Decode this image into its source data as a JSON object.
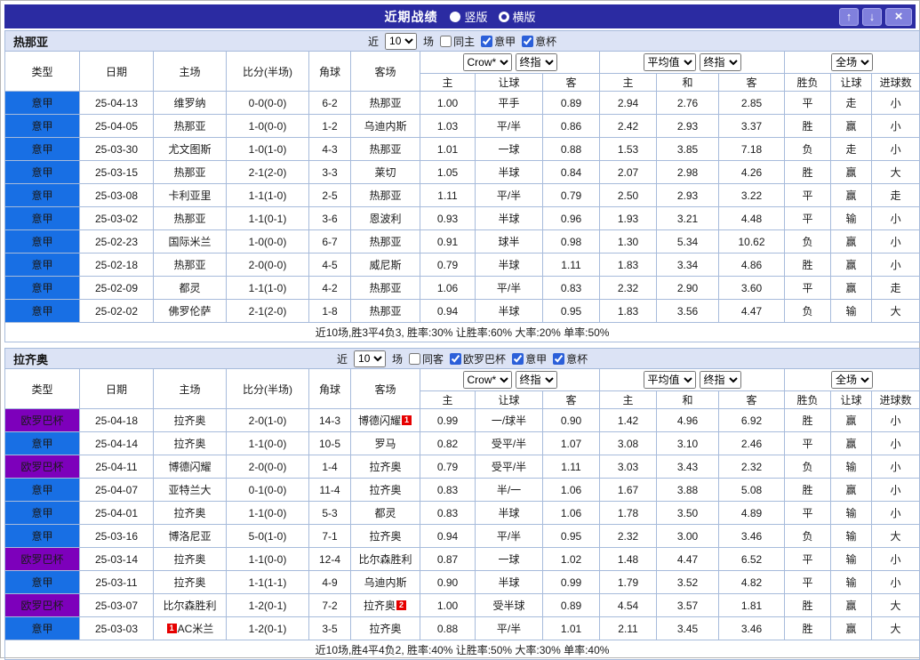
{
  "titlebar": {
    "title": "近期战绩",
    "options": [
      {
        "label": "竖版",
        "selected": false
      },
      {
        "label": "横版",
        "selected": true
      }
    ],
    "buttons": {
      "up": "↑",
      "down": "↓",
      "close": "×"
    }
  },
  "header_labels": {
    "left": [
      "类型",
      "日期",
      "主场",
      "比分(半场)",
      "角球",
      "客场"
    ],
    "group1": [
      "主",
      "让球",
      "客"
    ],
    "group2": [
      "主",
      "和",
      "客"
    ],
    "group3": [
      "胜负",
      "让球",
      "进球数"
    ],
    "selects": {
      "odds_source": "Crow*",
      "stage1": "终指",
      "avg": "平均值",
      "stage2": "终指",
      "scope": "全场"
    }
  },
  "colors": {
    "league_serie_a": "#186fe4",
    "league_europa": "#7d00bb",
    "win": "#e60000",
    "loss": "#00912c",
    "push_purple": "#7700cc",
    "titlebar": "#2b2ba2",
    "section_bg": "#dce3f5"
  },
  "sections": [
    {
      "team": "热那亚",
      "filters": {
        "near": "近",
        "count": "10",
        "unit": "场",
        "checkboxes": [
          {
            "label": "同主",
            "checked": false
          },
          {
            "label": "意甲",
            "checked": true
          },
          {
            "label": "意杯",
            "checked": true
          }
        ]
      },
      "summary": "近10场,胜3平4负3, 胜率:30% 让胜率:60% 大率:20% 单率:50%",
      "rows": [
        {
          "league": "意甲",
          "lc": "blue",
          "date": "25-04-13",
          "home": "维罗纳",
          "hg": false,
          "score": "0-0(0-0)",
          "corner": "6-2",
          "away": "热那亚",
          "ag": true,
          "o1": "1.00",
          "hcp": "平手",
          "o2": "0.89",
          "m1": "2.94",
          "m2": "2.76",
          "m3": "2.85",
          "res": "平",
          "resc": "k",
          "lres": "走",
          "lresc": "g",
          "ou": "小",
          "ouc": "g"
        },
        {
          "league": "意甲",
          "lc": "blue",
          "date": "25-04-05",
          "home": "热那亚",
          "hg": true,
          "score": "1-0(0-0)",
          "corner": "1-2",
          "away": "乌迪内斯",
          "ag": false,
          "o1": "1.03",
          "hcp": "平/半",
          "o2": "0.86",
          "m1": "2.42",
          "m2": "2.93",
          "m3": "3.37",
          "res": "胜",
          "resc": "r",
          "lres": "赢",
          "lresc": "r",
          "ou": "小",
          "ouc": "g"
        },
        {
          "league": "意甲",
          "lc": "blue",
          "date": "25-03-30",
          "home": "尤文图斯",
          "hg": false,
          "score": "1-0(1-0)",
          "corner": "4-3",
          "away": "热那亚",
          "ag": true,
          "o1": "1.01",
          "hcp": "一球",
          "o2": "0.88",
          "m1": "1.53",
          "m2": "3.85",
          "m3": "7.18",
          "res": "负",
          "resc": "g",
          "lres": "走",
          "lresc": "g",
          "ou": "小",
          "ouc": "g"
        },
        {
          "league": "意甲",
          "lc": "blue",
          "date": "25-03-15",
          "home": "热那亚",
          "hg": true,
          "score": "2-1(2-0)",
          "corner": "3-3",
          "away": "莱切",
          "ag": false,
          "o1": "1.05",
          "hcp": "半球",
          "o2": "0.84",
          "m1": "2.07",
          "m2": "2.98",
          "m3": "4.26",
          "res": "胜",
          "resc": "r",
          "lres": "赢",
          "lresc": "r",
          "ou": "大",
          "ouc": "r"
        },
        {
          "league": "意甲",
          "lc": "blue",
          "date": "25-03-08",
          "home": "卡利亚里",
          "hg": false,
          "score": "1-1(1-0)",
          "corner": "2-5",
          "away": "热那亚",
          "ag": true,
          "o1": "1.11",
          "hcp": "平/半",
          "o2": "0.79",
          "m1": "2.50",
          "m2": "2.93",
          "m3": "3.22",
          "res": "平",
          "resc": "k",
          "lres": "赢",
          "lresc": "r",
          "ou": "走",
          "ouc": "g"
        },
        {
          "league": "意甲",
          "lc": "blue",
          "date": "25-03-02",
          "home": "热那亚",
          "hg": true,
          "score": "1-1(0-1)",
          "corner": "3-6",
          "away": "恩波利",
          "ag": false,
          "o1": "0.93",
          "hcp": "半球",
          "o2": "0.96",
          "m1": "1.93",
          "m2": "3.21",
          "m3": "4.48",
          "res": "平",
          "resc": "k",
          "lres": "输",
          "lresc": "p",
          "ou": "小",
          "ouc": "g"
        },
        {
          "league": "意甲",
          "lc": "blue",
          "date": "25-02-23",
          "home": "国际米兰",
          "hg": false,
          "score": "1-0(0-0)",
          "corner": "6-7",
          "away": "热那亚",
          "ag": true,
          "o1": "0.91",
          "hcp": "球半",
          "o2": "0.98",
          "m1": "1.30",
          "m2": "5.34",
          "m3": "10.62",
          "res": "负",
          "resc": "g",
          "lres": "赢",
          "lresc": "r",
          "ou": "小",
          "ouc": "g"
        },
        {
          "league": "意甲",
          "lc": "blue",
          "date": "25-02-18",
          "home": "热那亚",
          "hg": true,
          "score": "2-0(0-0)",
          "corner": "4-5",
          "away": "威尼斯",
          "ag": false,
          "o1": "0.79",
          "hcp": "半球",
          "o2": "1.11",
          "m1": "1.83",
          "m2": "3.34",
          "m3": "4.86",
          "res": "胜",
          "resc": "r",
          "lres": "赢",
          "lresc": "r",
          "ou": "小",
          "ouc": "g"
        },
        {
          "league": "意甲",
          "lc": "blue",
          "date": "25-02-09",
          "home": "都灵",
          "hg": false,
          "score": "1-1(1-0)",
          "corner": "4-2",
          "away": "热那亚",
          "ag": true,
          "o1": "1.06",
          "hcp": "平/半",
          "o2": "0.83",
          "m1": "2.32",
          "m2": "2.90",
          "m3": "3.60",
          "res": "平",
          "resc": "k",
          "lres": "赢",
          "lresc": "r",
          "ou": "走",
          "ouc": "g"
        },
        {
          "league": "意甲",
          "lc": "blue",
          "date": "25-02-02",
          "home": "佛罗伦萨",
          "hg": false,
          "score": "2-1(2-0)",
          "corner": "1-8",
          "away": "热那亚",
          "ag": true,
          "o1": "0.94",
          "hcp": "半球",
          "o2": "0.95",
          "m1": "1.83",
          "m2": "3.56",
          "m3": "4.47",
          "res": "负",
          "resc": "g",
          "lres": "输",
          "lresc": "p",
          "ou": "大",
          "ouc": "r"
        }
      ]
    },
    {
      "team": "拉齐奥",
      "filters": {
        "near": "近",
        "count": "10",
        "unit": "场",
        "checkboxes": [
          {
            "label": "同客",
            "checked": false
          },
          {
            "label": "欧罗巴杯",
            "checked": true
          },
          {
            "label": "意甲",
            "checked": true
          },
          {
            "label": "意杯",
            "checked": true
          }
        ]
      },
      "summary": "近10场,胜4平4负2, 胜率:40% 让胜率:50% 大率:30% 单率:40%",
      "rows": [
        {
          "league": "欧罗巴杯",
          "lc": "purple",
          "date": "25-04-18",
          "home": "拉齐奥",
          "hg": true,
          "score": "2-0(1-0)",
          "corner": "14-3",
          "away": "博德闪耀",
          "ag": false,
          "ab": "1",
          "abp": "after",
          "o1": "0.99",
          "hcp": "一/球半",
          "o2": "0.90",
          "m1": "1.42",
          "m2": "4.96",
          "m3": "6.92",
          "res": "胜",
          "resc": "r",
          "lres": "赢",
          "lresc": "r",
          "ou": "小",
          "ouc": "g"
        },
        {
          "league": "意甲",
          "lc": "blue",
          "date": "25-04-14",
          "home": "拉齐奥",
          "hg": true,
          "score": "1-1(0-0)",
          "corner": "10-5",
          "away": "罗马",
          "ag": false,
          "o1": "0.82",
          "hcp": "受平/半",
          "o2": "1.07",
          "m1": "3.08",
          "m2": "3.10",
          "m3": "2.46",
          "res": "平",
          "resc": "k",
          "lres": "赢",
          "lresc": "r",
          "ou": "小",
          "ouc": "g"
        },
        {
          "league": "欧罗巴杯",
          "lc": "purple",
          "date": "25-04-11",
          "home": "博德闪耀",
          "hg": false,
          "score": "2-0(0-0)",
          "corner": "1-4",
          "away": "拉齐奥",
          "ag": true,
          "o1": "0.79",
          "hcp": "受平/半",
          "o2": "1.11",
          "m1": "3.03",
          "m2": "3.43",
          "m3": "2.32",
          "res": "负",
          "resc": "g",
          "lres": "输",
          "lresc": "p",
          "ou": "小",
          "ouc": "g"
        },
        {
          "league": "意甲",
          "lc": "blue",
          "date": "25-04-07",
          "home": "亚特兰大",
          "hg": false,
          "score": "0-1(0-0)",
          "corner": "11-4",
          "away": "拉齐奥",
          "ag": true,
          "o1": "0.83",
          "hcp": "半/一",
          "o2": "1.06",
          "m1": "1.67",
          "m2": "3.88",
          "m3": "5.08",
          "res": "胜",
          "resc": "r",
          "lres": "赢",
          "lresc": "r",
          "ou": "小",
          "ouc": "g"
        },
        {
          "league": "意甲",
          "lc": "blue",
          "date": "25-04-01",
          "home": "拉齐奥",
          "hg": true,
          "score": "1-1(0-0)",
          "corner": "5-3",
          "away": "都灵",
          "ag": false,
          "o1": "0.83",
          "hcp": "半球",
          "o2": "1.06",
          "m1": "1.78",
          "m2": "3.50",
          "m3": "4.89",
          "res": "平",
          "resc": "k",
          "lres": "输",
          "lresc": "p",
          "ou": "小",
          "ouc": "g"
        },
        {
          "league": "意甲",
          "lc": "blue",
          "date": "25-03-16",
          "home": "博洛尼亚",
          "hg": false,
          "score": "5-0(1-0)",
          "corner": "7-1",
          "away": "拉齐奥",
          "ag": true,
          "o1": "0.94",
          "hcp": "平/半",
          "o2": "0.95",
          "m1": "2.32",
          "m2": "3.00",
          "m3": "3.46",
          "res": "负",
          "resc": "g",
          "lres": "输",
          "lresc": "p",
          "ou": "大",
          "ouc": "r"
        },
        {
          "league": "欧罗巴杯",
          "lc": "purple",
          "date": "25-03-14",
          "home": "拉齐奥",
          "hg": true,
          "score": "1-1(0-0)",
          "corner": "12-4",
          "away": "比尔森胜利",
          "ag": false,
          "o1": "0.87",
          "hcp": "一球",
          "o2": "1.02",
          "m1": "1.48",
          "m2": "4.47",
          "m3": "6.52",
          "res": "平",
          "resc": "k",
          "lres": "输",
          "lresc": "p",
          "ou": "小",
          "ouc": "g"
        },
        {
          "league": "意甲",
          "lc": "blue",
          "date": "25-03-11",
          "home": "拉齐奥",
          "hg": true,
          "score": "1-1(1-1)",
          "corner": "4-9",
          "away": "乌迪内斯",
          "ag": false,
          "o1": "0.90",
          "hcp": "半球",
          "o2": "0.99",
          "m1": "1.79",
          "m2": "3.52",
          "m3": "4.82",
          "res": "平",
          "resc": "k",
          "lres": "输",
          "lresc": "p",
          "ou": "小",
          "ouc": "g"
        },
        {
          "league": "欧罗巴杯",
          "lc": "purple",
          "date": "25-03-07",
          "home": "比尔森胜利",
          "hg": false,
          "score": "1-2(0-1)",
          "corner": "7-2",
          "away": "拉齐奥",
          "ag": true,
          "ab": "2",
          "abp": "after",
          "o1": "1.00",
          "hcp": "受半球",
          "o2": "0.89",
          "m1": "4.54",
          "m2": "3.57",
          "m3": "1.81",
          "res": "胜",
          "resc": "r",
          "lres": "赢",
          "lresc": "r",
          "ou": "大",
          "ouc": "r"
        },
        {
          "league": "意甲",
          "lc": "blue",
          "date": "25-03-03",
          "home": "AC米兰",
          "hg": false,
          "hb": "1",
          "hbp": "before",
          "score": "1-2(0-1)",
          "corner": "3-5",
          "away": "拉齐奥",
          "ag": true,
          "o1": "0.88",
          "hcp": "平/半",
          "o2": "1.01",
          "m1": "2.11",
          "m2": "3.45",
          "m3": "3.46",
          "res": "胜",
          "resc": "r",
          "lres": "赢",
          "lresc": "r",
          "ou": "大",
          "ouc": "r"
        }
      ]
    }
  ]
}
